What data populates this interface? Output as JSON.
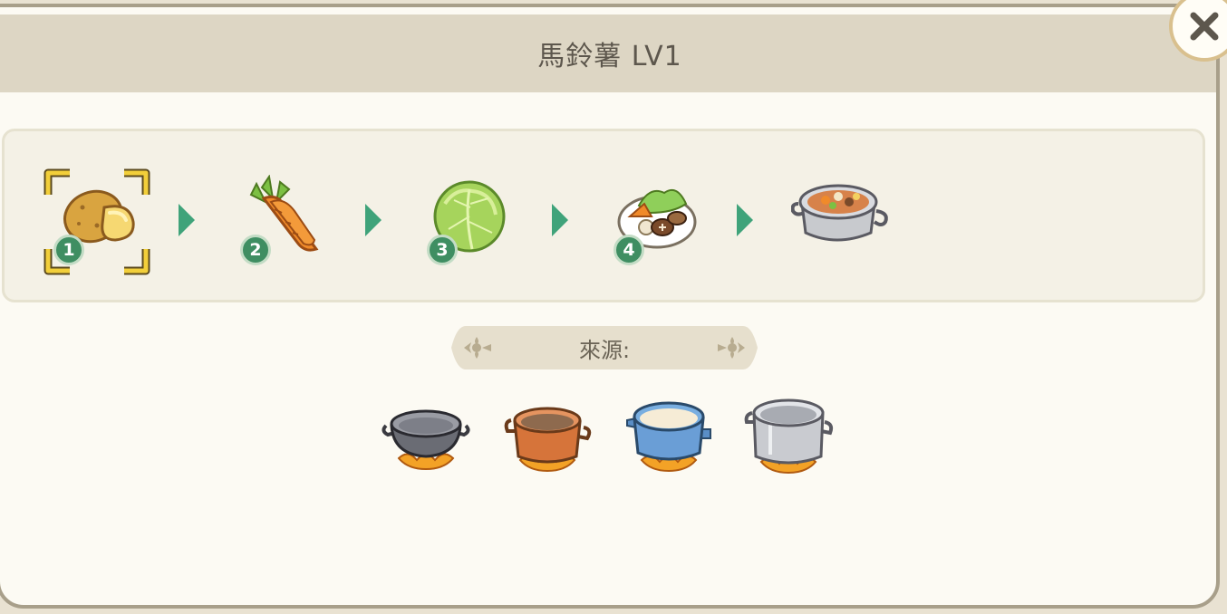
{
  "header": {
    "title": "馬鈴薯 LV1"
  },
  "close_button": {
    "icon": "close-icon"
  },
  "merge_chain": {
    "items": [
      {
        "icon": "potato-icon",
        "level": "1",
        "selected": true
      },
      {
        "icon": "carrot-icon",
        "level": "2"
      },
      {
        "icon": "cabbage-icon",
        "level": "3"
      },
      {
        "icon": "vegetable-plate-icon",
        "level": "4"
      },
      {
        "icon": "stew-pot-icon"
      }
    ]
  },
  "source": {
    "label": "來源:",
    "items": [
      {
        "icon": "grey-wok-icon"
      },
      {
        "icon": "copper-pot-icon"
      },
      {
        "icon": "blue-pot-icon"
      },
      {
        "icon": "steel-pot-icon"
      }
    ]
  },
  "colors": {
    "header_bg": "#ddd6c4",
    "panel_bg": "#fcfaf3",
    "badge_green": "#3f8e62",
    "arrow_green": "#3fa37a",
    "selector_yellow": "#f2cf3a"
  }
}
